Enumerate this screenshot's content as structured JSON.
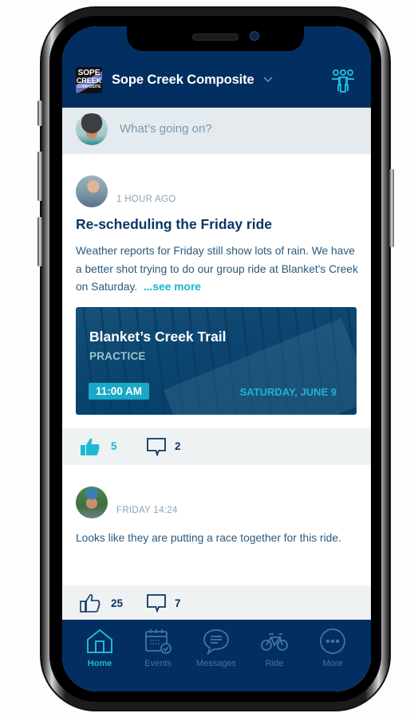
{
  "header": {
    "logo_text_lines": [
      "SOPE",
      "CREEK",
      "COMPOSITE"
    ],
    "club_name": "Sope Creek Composite",
    "club_switcher_icon": "chevron-down-icon",
    "members_icon": "group-icon"
  },
  "composer": {
    "placeholder": "What’s going on?"
  },
  "posts": [
    {
      "timestamp": "1 HOUR AGO",
      "title": "Re-scheduling the Friday ride",
      "body": "Weather reports for Friday still show lots of rain. We have a better shot trying to do our group ride at Blanket's Creek on Saturday.",
      "see_more": "...see more",
      "event": {
        "title": "Blanket’s Creek Trail",
        "type": "PRACTICE",
        "time": "11:00 AM",
        "date": "SATURDAY, JUNE 9"
      },
      "likes": "5",
      "liked": true,
      "comments": "2"
    },
    {
      "timestamp": "FRIDAY 14:24",
      "body": "Looks like they are putting a race together for this ride.",
      "likes": "25",
      "liked": false,
      "comments": "7"
    }
  ],
  "tabbar": {
    "tabs": [
      {
        "label": "Home",
        "icon": "home-icon",
        "active": true
      },
      {
        "label": "Events",
        "icon": "calendar-icon",
        "active": false
      },
      {
        "label": "Messages",
        "icon": "chat-bubble-icon",
        "active": false
      },
      {
        "label": "Ride",
        "icon": "bicycle-icon",
        "active": false
      },
      {
        "label": "More",
        "icon": "more-icon",
        "active": false
      }
    ]
  },
  "colors": {
    "brand_navy": "#022e61",
    "accent_cyan": "#1fb9d6",
    "text_blue": "#2a5a7e",
    "meta_gray": "#8aa2b4",
    "composer_bg": "#e4eaee",
    "actions_bg": "#eff2f3"
  }
}
